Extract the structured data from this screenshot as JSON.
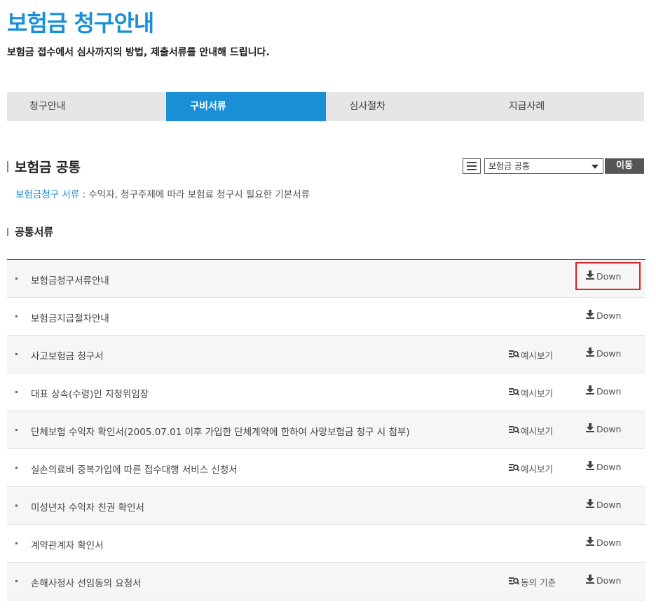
{
  "page": {
    "title": "보험금 청구안내",
    "subtitle": "보험금 접수에서 심사까지의 방법, 제출서류를 안내해 드립니다."
  },
  "tabs": [
    {
      "label": "청구안내",
      "active": false
    },
    {
      "label": "구비서류",
      "active": true
    },
    {
      "label": "심사절차",
      "active": false
    },
    {
      "label": "지급사례",
      "active": false
    }
  ],
  "section": {
    "title": "보험금 공통",
    "select_value": "보험금 공통",
    "go_label": "이동",
    "desc_highlight": "보험금청구 서류",
    "desc_text": " : 수익자, 청구주제에 따라 보험료 청구시 필요한 기본서류"
  },
  "subsection": {
    "title": "공통서류"
  },
  "documents": [
    {
      "name": "보험금청구서류안내",
      "example": "",
      "down": "Down",
      "highlight": true
    },
    {
      "name": "보험금지급절차안내",
      "example": "",
      "down": "Down",
      "highlight": false
    },
    {
      "name": "사고보험금 청구서",
      "example": "예시보기",
      "down": "Down",
      "highlight": false
    },
    {
      "name": "대표 상속(수령)인 지정위임장",
      "example": "예시보기",
      "down": "Down",
      "highlight": false
    },
    {
      "name": "단체보험 수익자 확인서(2005.07.01 이후 가입한 단체계약에 한하여 사망보험금 청구 시 첨부)",
      "example": "예시보기",
      "down": "Down",
      "highlight": false
    },
    {
      "name": "실손의료비 중복가입에 따른 접수대행 서비스 신청서",
      "example": "예시보기",
      "down": "Down",
      "highlight": false
    },
    {
      "name": "미성년자 수익자 친권 확인서",
      "example": "",
      "down": "Down",
      "highlight": false
    },
    {
      "name": "계약관계자 확인서",
      "example": "",
      "down": "Down",
      "highlight": false
    },
    {
      "name": "손해사정사 선임동의 요청서",
      "example": "동의 기준",
      "down": "Down",
      "highlight": false
    }
  ],
  "colors": {
    "accent": "#1a8fd6",
    "highlight_border": "#e02020",
    "tab_bg": "#e6e6e6",
    "go_button": "#555555"
  }
}
